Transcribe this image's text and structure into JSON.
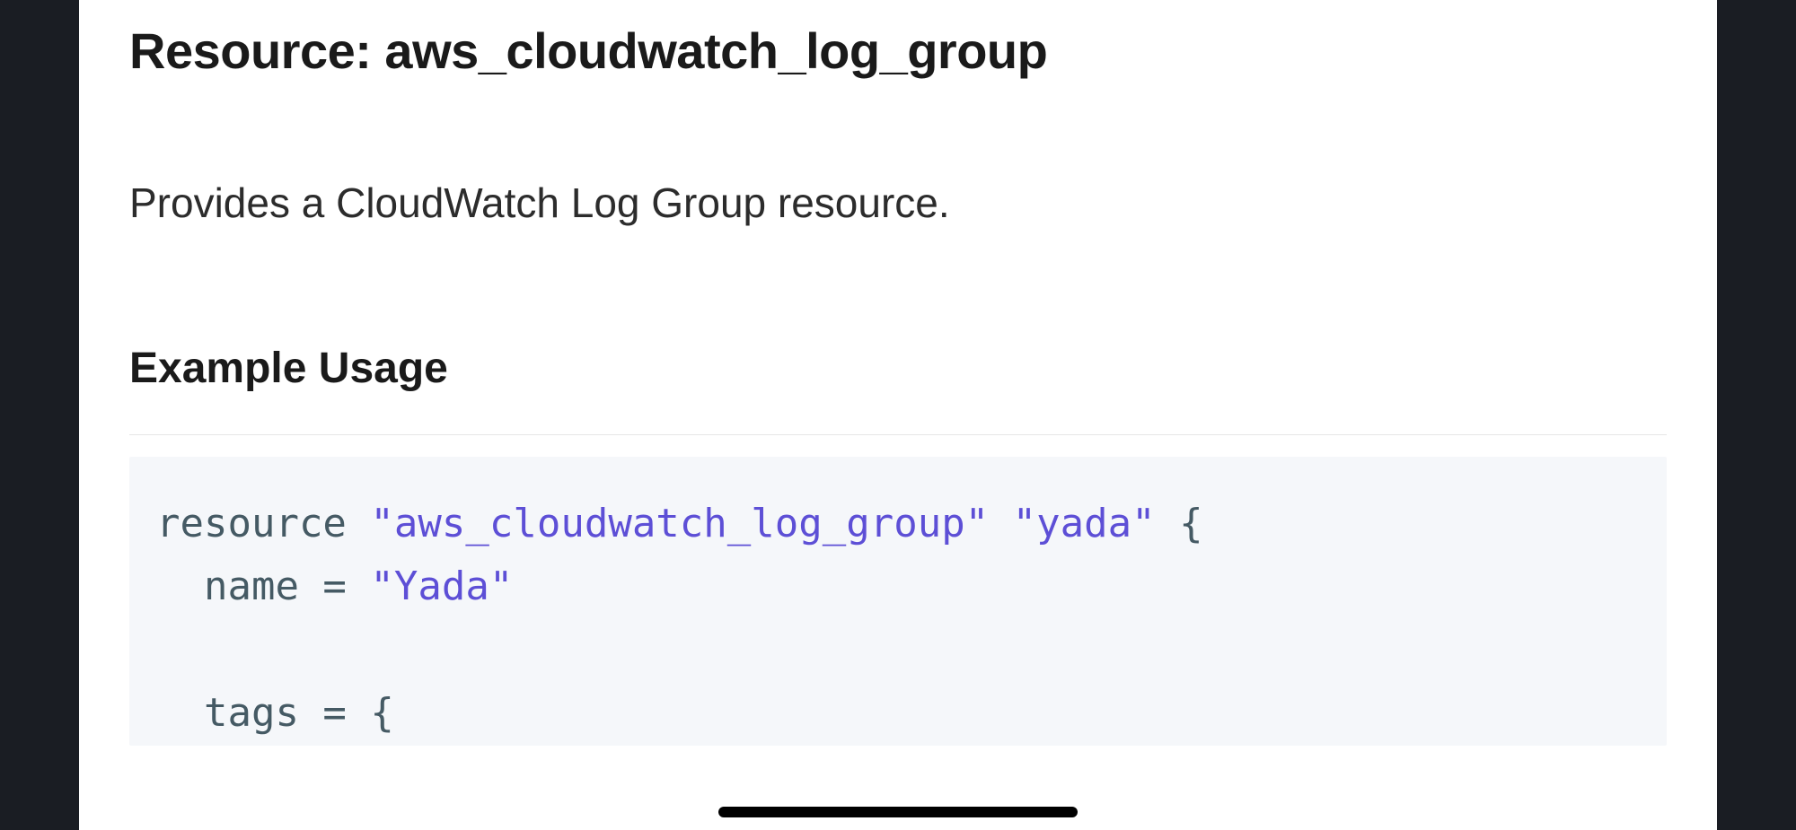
{
  "title": "Resource: aws_cloudwatch_log_group",
  "description": "Provides a CloudWatch Log Group resource.",
  "section_heading": "Example Usage",
  "code": {
    "l1_kw": "resource ",
    "l1_s1": "\"aws_cloudwatch_log_group\"",
    "l1_sp": " ",
    "l1_s2": "\"yada\"",
    "l1_end": " {",
    "l2_pre": "  name = ",
    "l2_str": "\"Yada\"",
    "l3_blank": "",
    "l4": "  tags = {"
  }
}
